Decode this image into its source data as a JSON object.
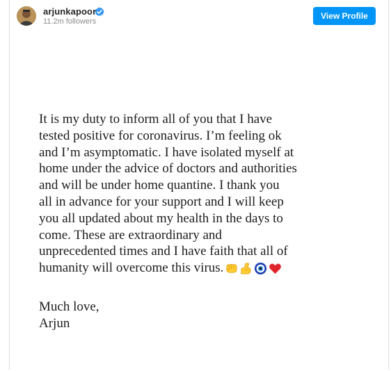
{
  "header": {
    "username": "arjunkapoor",
    "followers": "11.2m followers",
    "view_profile_label": "View Profile",
    "verified_icon": "verified-badge-icon",
    "accent_color": "#0095f6"
  },
  "post": {
    "lines": [
      "It is my duty to inform all of you that I have",
      "tested positive for coronavirus. I’m feeling ok",
      "and I’m asymptomatic. I have isolated myself at",
      "home under the advice of doctors and authorities",
      "and will be under home quantine. I thank you",
      "all in advance for your support and I will keep",
      "you all updated about my health in the days to",
      "come. These are extraordinary and",
      "unprecedented times and I have faith that all of",
      "humanity will overcome this virus."
    ],
    "emojis": [
      "fist-bump-icon",
      "flexed-biceps-icon",
      "nazar-amulet-icon",
      "red-heart-icon"
    ],
    "signoff_1": "Much love,",
    "signoff_2": "Arjun"
  }
}
